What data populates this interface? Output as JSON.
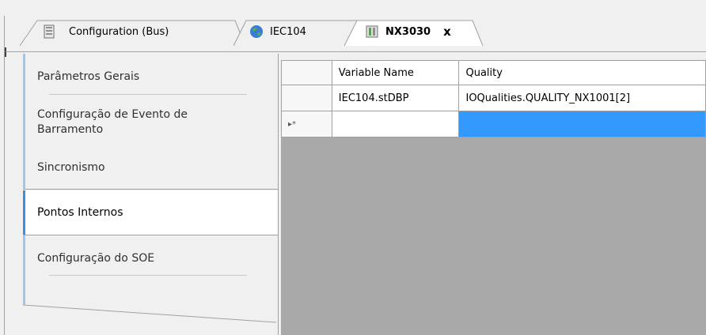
{
  "tabs": [
    {
      "label": "Configuration (Bus)",
      "icon": "bus-config-icon",
      "active": false
    },
    {
      "label": "IEC104",
      "icon": "globe-network-icon",
      "active": false
    },
    {
      "label": "NX3030",
      "icon": "cpu-module-icon",
      "active": true,
      "close": "x"
    }
  ],
  "sidebar": {
    "items": [
      {
        "label": "Parâmetros Gerais"
      },
      {
        "label": "Configuração de Evento de Barramento"
      },
      {
        "label": "Sincronismo"
      },
      {
        "label": "Pontos Internos"
      },
      {
        "label": "Configuração do SOE"
      }
    ]
  },
  "grid": {
    "columns": [
      "Variable Name",
      "Quality"
    ],
    "rows": [
      {
        "marker": "",
        "variable": "IEC104.stDBP",
        "quality": "IOQualities.QUALITY_NX1001[2]"
      }
    ],
    "new_row_marker": "▸*"
  },
  "colors": {
    "accent": "#3c8fe0",
    "selection": "#3399ff",
    "grid_background": "#a9a9a9"
  }
}
